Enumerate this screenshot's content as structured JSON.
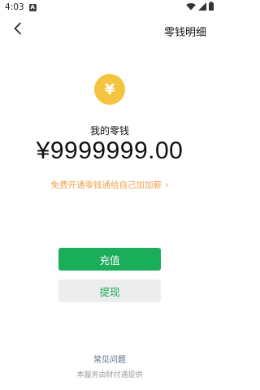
{
  "status_bar": {
    "time": "4:03",
    "app_badge": "A",
    "icons": [
      "wifi-icon",
      "signal-icon",
      "battery-icon"
    ]
  },
  "header": {
    "title": "零钱明细",
    "back_icon": "back-arrow-icon"
  },
  "balance": {
    "coin_symbol": "¥",
    "label": "我的零钱",
    "amount": "¥9999999.00"
  },
  "promo": {
    "text": "免费开通零钱通给自己加加薪",
    "chevron": "›"
  },
  "actions": {
    "recharge_label": "充值",
    "withdraw_label": "提现"
  },
  "footer": {
    "faq_label": "常见问题",
    "provider_note": "本服务由财付通提供"
  },
  "colors": {
    "accent_green": "#1aad5a",
    "coin_yellow": "#f5c43f",
    "promo_orange": "#f0a24c",
    "link_blue": "#576b95"
  }
}
